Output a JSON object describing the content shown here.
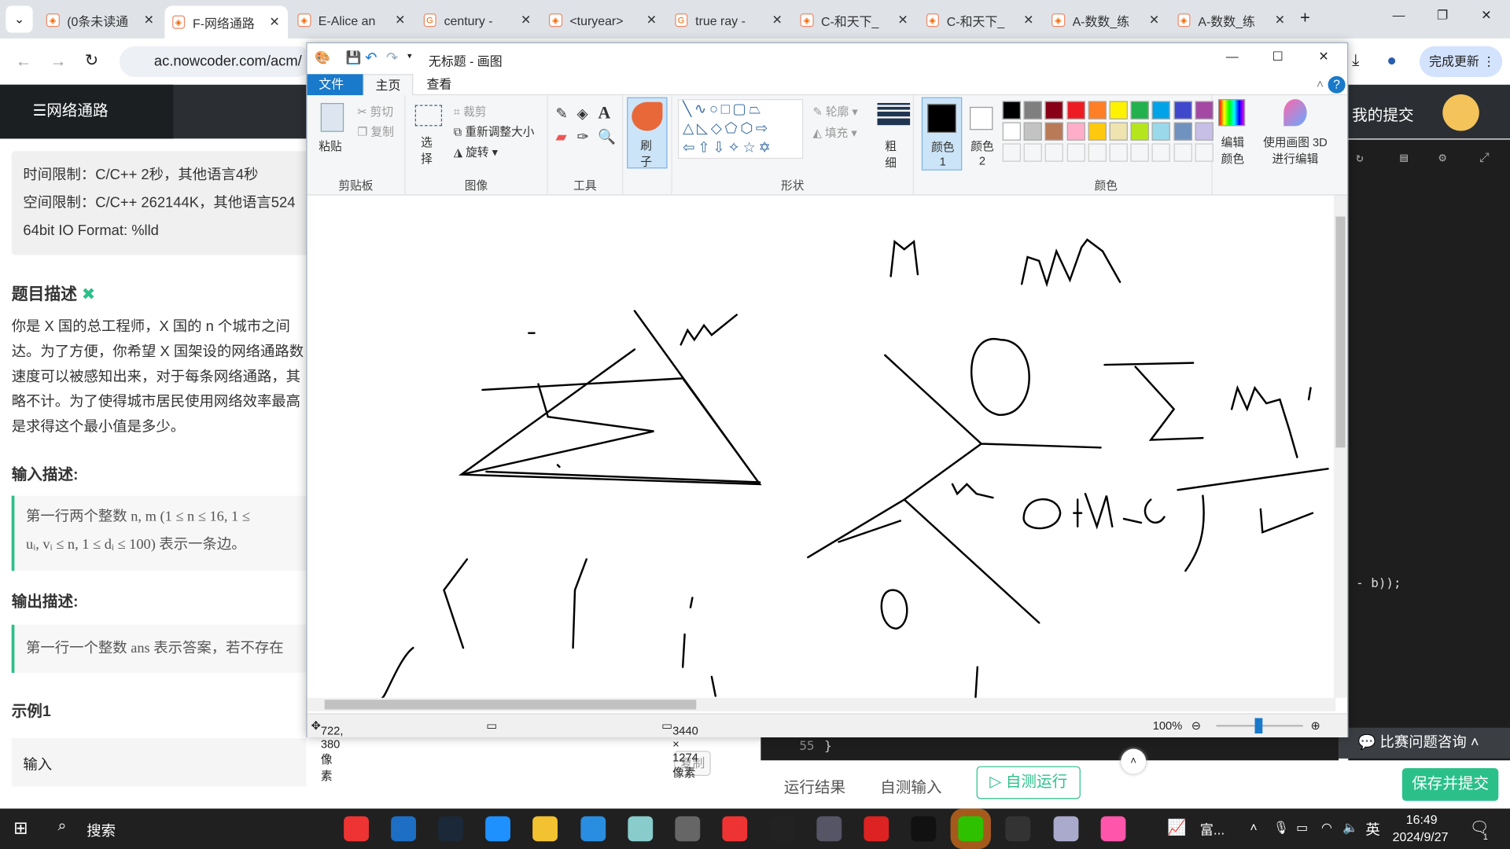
{
  "browser": {
    "tabs": [
      {
        "title": "(0条未读通",
        "icon": "nowcoder-icon"
      },
      {
        "title": "F-网络通路",
        "icon": "nowcoder-icon",
        "active": true
      },
      {
        "title": "E-Alice an",
        "icon": "nowcoder-icon"
      },
      {
        "title": "century -",
        "icon": "google-icon"
      },
      {
        "title": "<turyear>",
        "icon": "site-icon"
      },
      {
        "title": "true ray -",
        "icon": "google-icon"
      },
      {
        "title": "C-和天下_",
        "icon": "nowcoder-icon"
      },
      {
        "title": "C-和天下_",
        "icon": "nowcoder-icon"
      },
      {
        "title": "A-数数_练",
        "icon": "nowcoder-icon"
      },
      {
        "title": "A-数数_练",
        "icon": "nowcoder-icon"
      }
    ],
    "url": "ac.nowcoder.com/acm/",
    "update_button": "完成更新"
  },
  "page": {
    "problem_title": "网络通路",
    "my_submissions": "我的提交",
    "limits": [
      "时间限制：C/C++ 2秒，其他语言4秒",
      "空间限制：C/C++ 262144K，其他语言524",
      "64bit IO Format: %lld"
    ],
    "desc_heading": "题目描述",
    "desc_lines": [
      "你是 X 国的总工程师，X 国的 n 个城市之间",
      "达。为了方便，你希望 X 国架设的网络通路数",
      "速度可以被感知出来，对于每条网络通路，其",
      "略不计。为了使得城市居民使用网络效率最高",
      "是求得这个最小值是多少。"
    ],
    "input_heading": "输入描述:",
    "input_lines": [
      "第一行两个整数 n, m (1 ≤ n ≤ 16, 1 ≤",
      "uᵢ, vᵢ ≤ n, 1 ≤ dᵢ ≤ 100) 表示一条边。"
    ],
    "output_heading": "输出描述:",
    "output_line": "第一行一个整数 ans 表示答案，若不存在",
    "example_heading": "示例1",
    "input_label": "输入",
    "copy_button": "复制",
    "code_line": "- b));",
    "code_last_line_no": "55",
    "code_last_line": "}",
    "run_result_tab": "运行结果",
    "self_input_tab": "自测输入",
    "self_run_button": "自测运行",
    "save_submit_button": "保存并提交",
    "consult_button": "比赛问题咨询"
  },
  "paint": {
    "title": "无标题 - 画图",
    "menu": [
      "文件",
      "主页",
      "查看"
    ],
    "clipboard": {
      "paste": "粘贴",
      "cut": "剪切",
      "copy": "复制",
      "label": "剪贴板"
    },
    "image": {
      "select": "选择",
      "crop": "裁剪",
      "resize": "重新调整大小",
      "rotate": "旋转",
      "label": "图像"
    },
    "tools_label": "工具",
    "brush": "刷子",
    "shapes": {
      "outline": "轮廓",
      "fill": "填充",
      "label": "形状"
    },
    "size": "粗细",
    "color1": "颜色 1",
    "color2": "颜色 2",
    "colors_label": "颜色",
    "edit_colors": "编辑颜色",
    "paint3d": "使用画图 3D 进行编辑",
    "palette": [
      "#000000",
      "#7f7f7f",
      "#880015",
      "#ed1c24",
      "#ff7f27",
      "#fff200",
      "#22b14c",
      "#00a2e8",
      "#3f48cc",
      "#a349a4",
      "#ffffff",
      "#c3c3c3",
      "#b97a57",
      "#ffaec9",
      "#ffc90e",
      "#efe4b0",
      "#b5e61d",
      "#99d9ea",
      "#7092be",
      "#c8bfe7"
    ],
    "status": {
      "cursor": "722, 380像素",
      "size": "3440 × 1274像素",
      "zoom": "100%"
    }
  },
  "taskbar": {
    "search": "搜索",
    "app_label": "富...",
    "ime": "英",
    "time": "16:49",
    "date": "2024/9/27",
    "notifications": "1"
  }
}
